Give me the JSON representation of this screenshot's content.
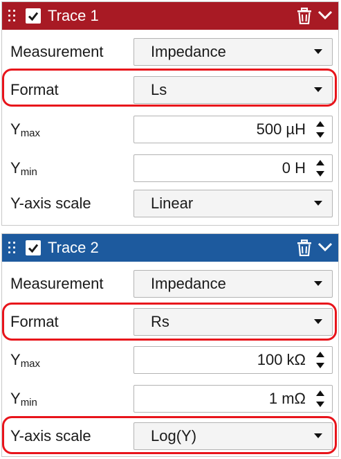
{
  "colors": {
    "trace1_header": "#a81a24",
    "trace2_header": "#1d5a9e",
    "highlight": "#e8141b"
  },
  "icons": {
    "drag": "drag-handle-icon",
    "check": "checkbox-checked-icon",
    "delete": "trash-icon",
    "collapse": "chevron-down-icon",
    "dropdown": "caret-down-icon",
    "spin": "spin-up-down-icon"
  },
  "trace1": {
    "title": "Trace 1",
    "measurement": {
      "label": "Measurement",
      "value": "Impedance"
    },
    "format": {
      "label": "Format",
      "value": "Ls"
    },
    "ymax": {
      "label": "Y",
      "sub": "max",
      "value": "500 µH"
    },
    "ymin": {
      "label": "Y",
      "sub": "min",
      "value": "0 H"
    },
    "yscale": {
      "label": "Y-axis scale",
      "value": "Linear"
    }
  },
  "trace2": {
    "title": "Trace 2",
    "measurement": {
      "label": "Measurement",
      "value": "Impedance"
    },
    "format": {
      "label": "Format",
      "value": "Rs"
    },
    "ymax": {
      "label": "Y",
      "sub": "max",
      "value": "100 kΩ"
    },
    "ymin": {
      "label": "Y",
      "sub": "min",
      "value": "1 mΩ"
    },
    "yscale": {
      "label": "Y-axis scale",
      "value": "Log(Y)"
    }
  }
}
